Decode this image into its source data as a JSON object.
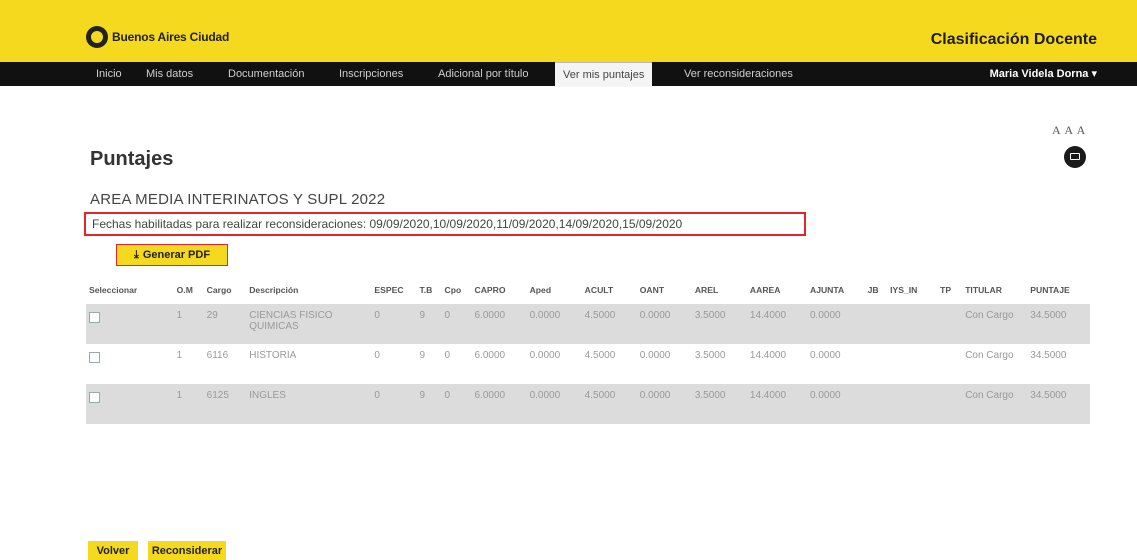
{
  "header": {
    "logo_text": "Buenos Aires Ciudad",
    "app_title": "Clasificación Docente"
  },
  "nav": {
    "items": [
      "Inicio",
      "Mis datos",
      "Documentación",
      "Inscripciones",
      "Adicional por título",
      "Ver mis puntajes",
      "Ver reconsideraciones"
    ],
    "active": "Ver mis puntajes",
    "user": "Maria Videla Dorna ▾"
  },
  "utility": {
    "font_sizes": "A A A",
    "mail_icon": "envelope-icon"
  },
  "page": {
    "title": "Puntajes",
    "area": "AREA MEDIA INTERINATOS Y SUPL 2022",
    "dates": "Fechas habilitadas para realizar reconsideraciones: 09/09/2020,10/09/2020,11/09/2020,14/09/2020,15/09/2020"
  },
  "pdf_button": {
    "icon": "download-icon",
    "label": "Generar PDF"
  },
  "table": {
    "headers": [
      "Seleccionar",
      "O.M",
      "Cargo",
      "Descripción",
      "ESPEC",
      "T.B",
      "Cpo",
      "CAPRO",
      "Aped",
      "ACULT",
      "OANT",
      "AREL",
      "AAREA",
      "AJUNTA",
      "JB",
      "IYS_IN",
      "TP",
      "TITULAR",
      "PUNTAJE"
    ],
    "rows": [
      [
        "",
        "1",
        "29",
        "CIENCIAS FISICO QUIMICAS",
        "0",
        "9",
        "0",
        "6.0000",
        "0.0000",
        "4.5000",
        "0.0000",
        "3.5000",
        "14.4000",
        "0.0000",
        "",
        "",
        "",
        "Con Cargo",
        "34.5000"
      ],
      [
        "",
        "1",
        "6116",
        "HISTORIA",
        "0",
        "9",
        "0",
        "6.0000",
        "0.0000",
        "4.5000",
        "0.0000",
        "3.5000",
        "14.4000",
        "0.0000",
        "",
        "",
        "",
        "Con Cargo",
        "34.5000"
      ],
      [
        "",
        "1",
        "6125",
        "INGLES",
        "0",
        "9",
        "0",
        "6.0000",
        "0.0000",
        "4.5000",
        "0.0000",
        "3.5000",
        "14.4000",
        "0.0000",
        "",
        "",
        "",
        "Con Cargo",
        "34.5000"
      ]
    ]
  },
  "footer": {
    "back": "Volver",
    "reconsider": "Reconsiderar"
  }
}
